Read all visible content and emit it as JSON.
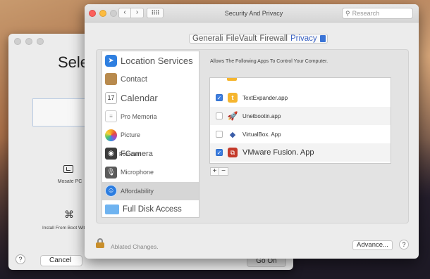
{
  "back_window": {
    "title": "Sele:",
    "option1_label": "Mosate PC",
    "option2_label": "Install From Boot With",
    "help_label": "?",
    "cancel_label": "Cancel",
    "go_on_label": "Go On"
  },
  "window": {
    "title": "Security And Privacy",
    "search_placeholder": "Research",
    "nav_back": "‹",
    "nav_forward": "›",
    "grid": "⠿⠿"
  },
  "tabs": [
    "Generali",
    "FileVault",
    "Firewall",
    "Privacy"
  ],
  "active_tab": "Privacy",
  "sidebar": {
    "items": [
      {
        "label": "Location Services",
        "icon": "location-arrow-icon"
      },
      {
        "label": "Contact",
        "icon": "contacts-book-icon"
      },
      {
        "label": "Calendar",
        "icon": "calendar-icon"
      },
      {
        "label": "Pro Memoria",
        "icon": "reminders-icon"
      },
      {
        "label": "Picture",
        "icon": "photos-icon"
      },
      {
        "label": "FCamera",
        "icon": "camera-icon"
      },
      {
        "label": "Microphone",
        "icon": "microphone-icon"
      },
      {
        "label": "Affordability",
        "icon": "accessibility-icon"
      },
      {
        "label": "Full Disk Access",
        "icon": "folder-icon"
      }
    ],
    "camera_overlay": "Fotocam",
    "selected": "Affordability"
  },
  "apps_panel": {
    "title": "Allows The Following Apps To Control Your Computer.",
    "apps": [
      {
        "name": "TextExpander.app",
        "checked": true,
        "icon": "textexpander-icon"
      },
      {
        "name": "Unetbootin.app",
        "checked": false,
        "icon": "unetbootin-rocket-icon"
      },
      {
        "name": "VirtualBox. App",
        "checked": false,
        "icon": "virtualbox-cube-icon"
      },
      {
        "name": "VMware Fusion. App",
        "checked": true,
        "icon": "vmware-fusion-icon"
      }
    ],
    "add_label": "+",
    "remove_label": "−"
  },
  "footer": {
    "lock_label": "Ablated Changes.",
    "advanced_label": "Advance...",
    "help_label": "?"
  },
  "colors": {
    "accent": "#3d7ee0",
    "close": "#fc605c",
    "minimize": "#fdbc40"
  }
}
